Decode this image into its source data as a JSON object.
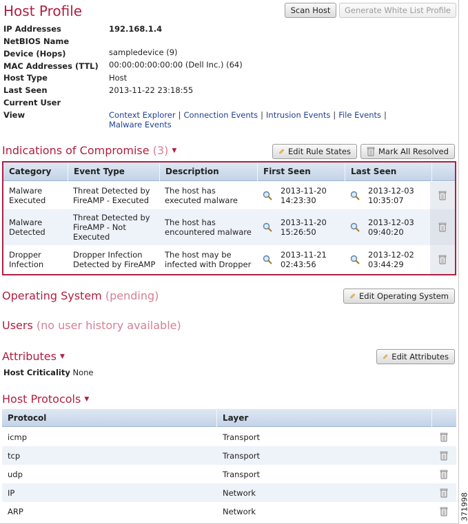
{
  "header": {
    "title": "Host Profile",
    "scan_host_label": "Scan Host",
    "generate_whitelist_label": "Generate White List Profile"
  },
  "host_info": {
    "rows": [
      {
        "label": "IP Addresses",
        "value": "192.168.1.4"
      },
      {
        "label": "NetBIOS Name",
        "value": ""
      },
      {
        "label": "Device (Hops)",
        "value": "sampledevice (9)"
      },
      {
        "label": "MAC Addresses (TTL)",
        "value": "00:00:00:00:00:00 (Dell Inc.) (64)"
      },
      {
        "label": "Host Type",
        "value": "Host"
      },
      {
        "label": "Last Seen",
        "value": "2013-11-22 23:18:55"
      },
      {
        "label": "Current User",
        "value": ""
      }
    ],
    "view_label": "View",
    "view_links": [
      "Context Explorer",
      "Connection Events",
      "Intrusion Events",
      "File Events",
      "Malware Events"
    ]
  },
  "ioc": {
    "title": "Indications of Compromise",
    "count": "(3)",
    "edit_rule_states_label": "Edit Rule States",
    "mark_all_resolved_label": "Mark All Resolved",
    "columns": [
      "Category",
      "Event Type",
      "Description",
      "First Seen",
      "Last Seen"
    ],
    "rows": [
      {
        "category": [
          "Malware",
          "Executed"
        ],
        "event_type": [
          "Threat Detected by",
          "FireAMP - Executed"
        ],
        "description": [
          "The host has",
          "executed malware"
        ],
        "first_seen": [
          "2013-11-20",
          "14:23:30"
        ],
        "last_seen": [
          "2013-12-03",
          "10:35:07"
        ]
      },
      {
        "category": [
          "Malware",
          "Detected"
        ],
        "event_type": [
          "Threat Detected by",
          "FireAMP - Not",
          "Executed"
        ],
        "description": [
          "The host has",
          "encountered malware"
        ],
        "first_seen": [
          "2013-11-20",
          "15:26:50"
        ],
        "last_seen": [
          "2013-12-03",
          "09:40:20"
        ]
      },
      {
        "category": [
          "Dropper",
          "Infection"
        ],
        "event_type": [
          "Dropper Infection",
          "Detected by FireAMP"
        ],
        "description": [
          "The host may be",
          "infected with Dropper"
        ],
        "first_seen": [
          "2013-11-21",
          "02:43:56"
        ],
        "last_seen": [
          "2013-12-02",
          "03:44:29"
        ]
      }
    ]
  },
  "operating_system": {
    "title": "Operating System",
    "status": "(pending)",
    "edit_label": "Edit Operating System"
  },
  "users": {
    "title": "Users",
    "status": "(no user history available)"
  },
  "attributes": {
    "title": "Attributes",
    "edit_label": "Edit Attributes",
    "host_criticality_label": "Host Criticality",
    "host_criticality_value": "None"
  },
  "host_protocols": {
    "title": "Host Protocols",
    "columns": [
      "Protocol",
      "Layer"
    ],
    "rows": [
      {
        "protocol": "icmp",
        "layer": "Transport"
      },
      {
        "protocol": "tcp",
        "layer": "Transport"
      },
      {
        "protocol": "udp",
        "layer": "Transport"
      },
      {
        "protocol": "IP",
        "layer": "Network"
      },
      {
        "protocol": "ARP",
        "layer": "Network"
      }
    ]
  },
  "figure_id": "371998",
  "colors": {
    "accent": "#b01e40",
    "muted_accent": "#d48097",
    "header_blue": "#c3d3e7",
    "link": "#1f3f8f"
  },
  "icons": [
    "magnifier-icon",
    "trash-icon",
    "pencil-icon",
    "caret-down-icon"
  ]
}
